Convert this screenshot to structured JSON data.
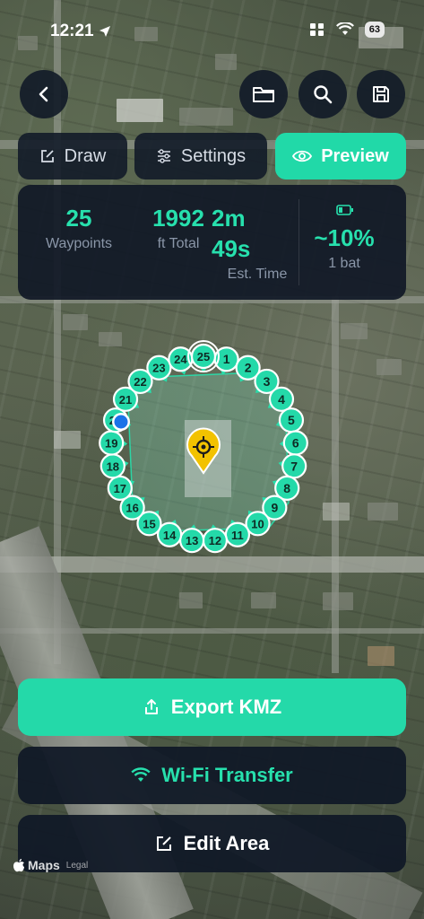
{
  "status_bar": {
    "time": "12:21",
    "battery": "63"
  },
  "modes": {
    "draw_label": "Draw",
    "settings_label": "Settings",
    "preview_label": "Preview",
    "active": "Preview"
  },
  "stats": {
    "waypoints_value": "25",
    "waypoints_label": "Waypoints",
    "distance_value": "1992",
    "distance_label": "ft Total",
    "time_value_line1": "2m",
    "time_value_line2": "49s",
    "time_label": "Est. Time",
    "battery_value": "~10%",
    "battery_label": "1 bat"
  },
  "waypoints": [
    "1",
    "2",
    "3",
    "4",
    "5",
    "6",
    "7",
    "8",
    "9",
    "10",
    "11",
    "12",
    "13",
    "14",
    "15",
    "16",
    "17",
    "18",
    "19",
    "20",
    "21",
    "22",
    "23",
    "24",
    "25"
  ],
  "actions": {
    "export_label": "Export KMZ",
    "wifi_label": "Wi-Fi Transfer",
    "edit_label": "Edit Area"
  },
  "map": {
    "credit": "Maps",
    "legal": "Legal"
  },
  "colors": {
    "accent": "#24d9a9",
    "panel": "#101826",
    "poi": "#f2c200",
    "location": "#1a73e8"
  }
}
